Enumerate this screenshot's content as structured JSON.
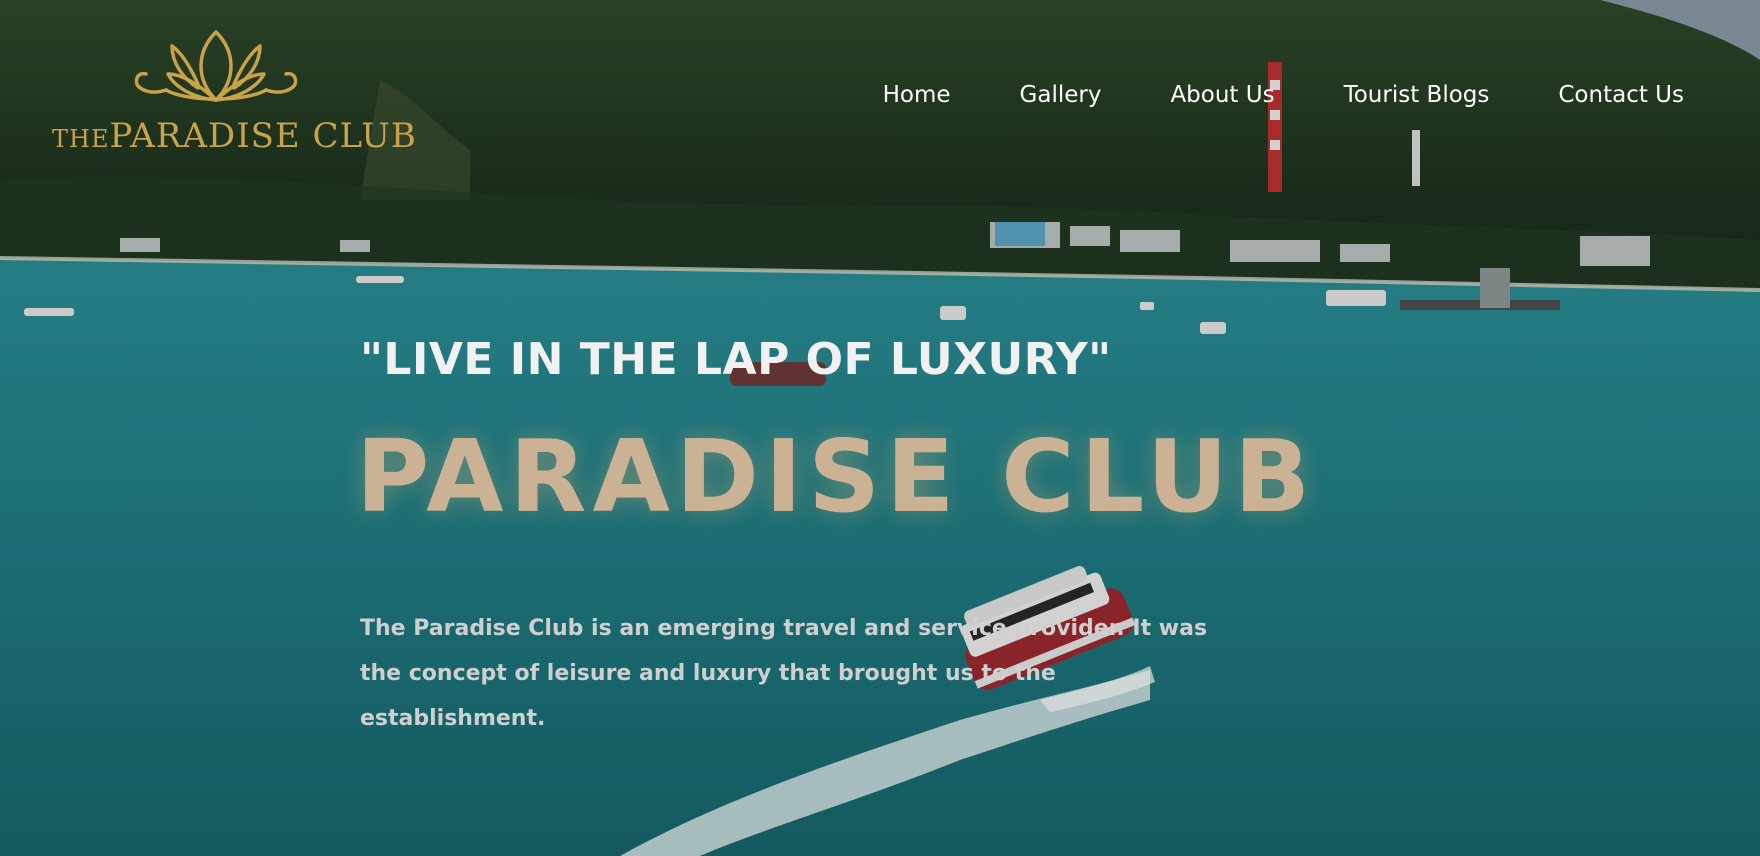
{
  "brand": {
    "logo_prefix": "THE",
    "logo_name": "PARADISE CLUB",
    "logo_color": "#c9a24a",
    "logo_icon": "lotus-icon"
  },
  "nav": {
    "items": [
      {
        "label": "Home"
      },
      {
        "label": "Gallery"
      },
      {
        "label": "About Us"
      },
      {
        "label": "Tourist Blogs"
      },
      {
        "label": "Contact Us"
      }
    ]
  },
  "hero": {
    "tagline": "\"LIVE IN THE LAP OF LUXURY\"",
    "title": "PARADISE CLUB",
    "title_color": "#cbb294",
    "description": "The Paradise Club is an emerging travel and service provider. It was the concept of leisure and luxury that brought us to the establishment."
  },
  "colors": {
    "sea": "#1f7f86",
    "hill": "#1f3a22",
    "nav_text": "#ffffff"
  }
}
